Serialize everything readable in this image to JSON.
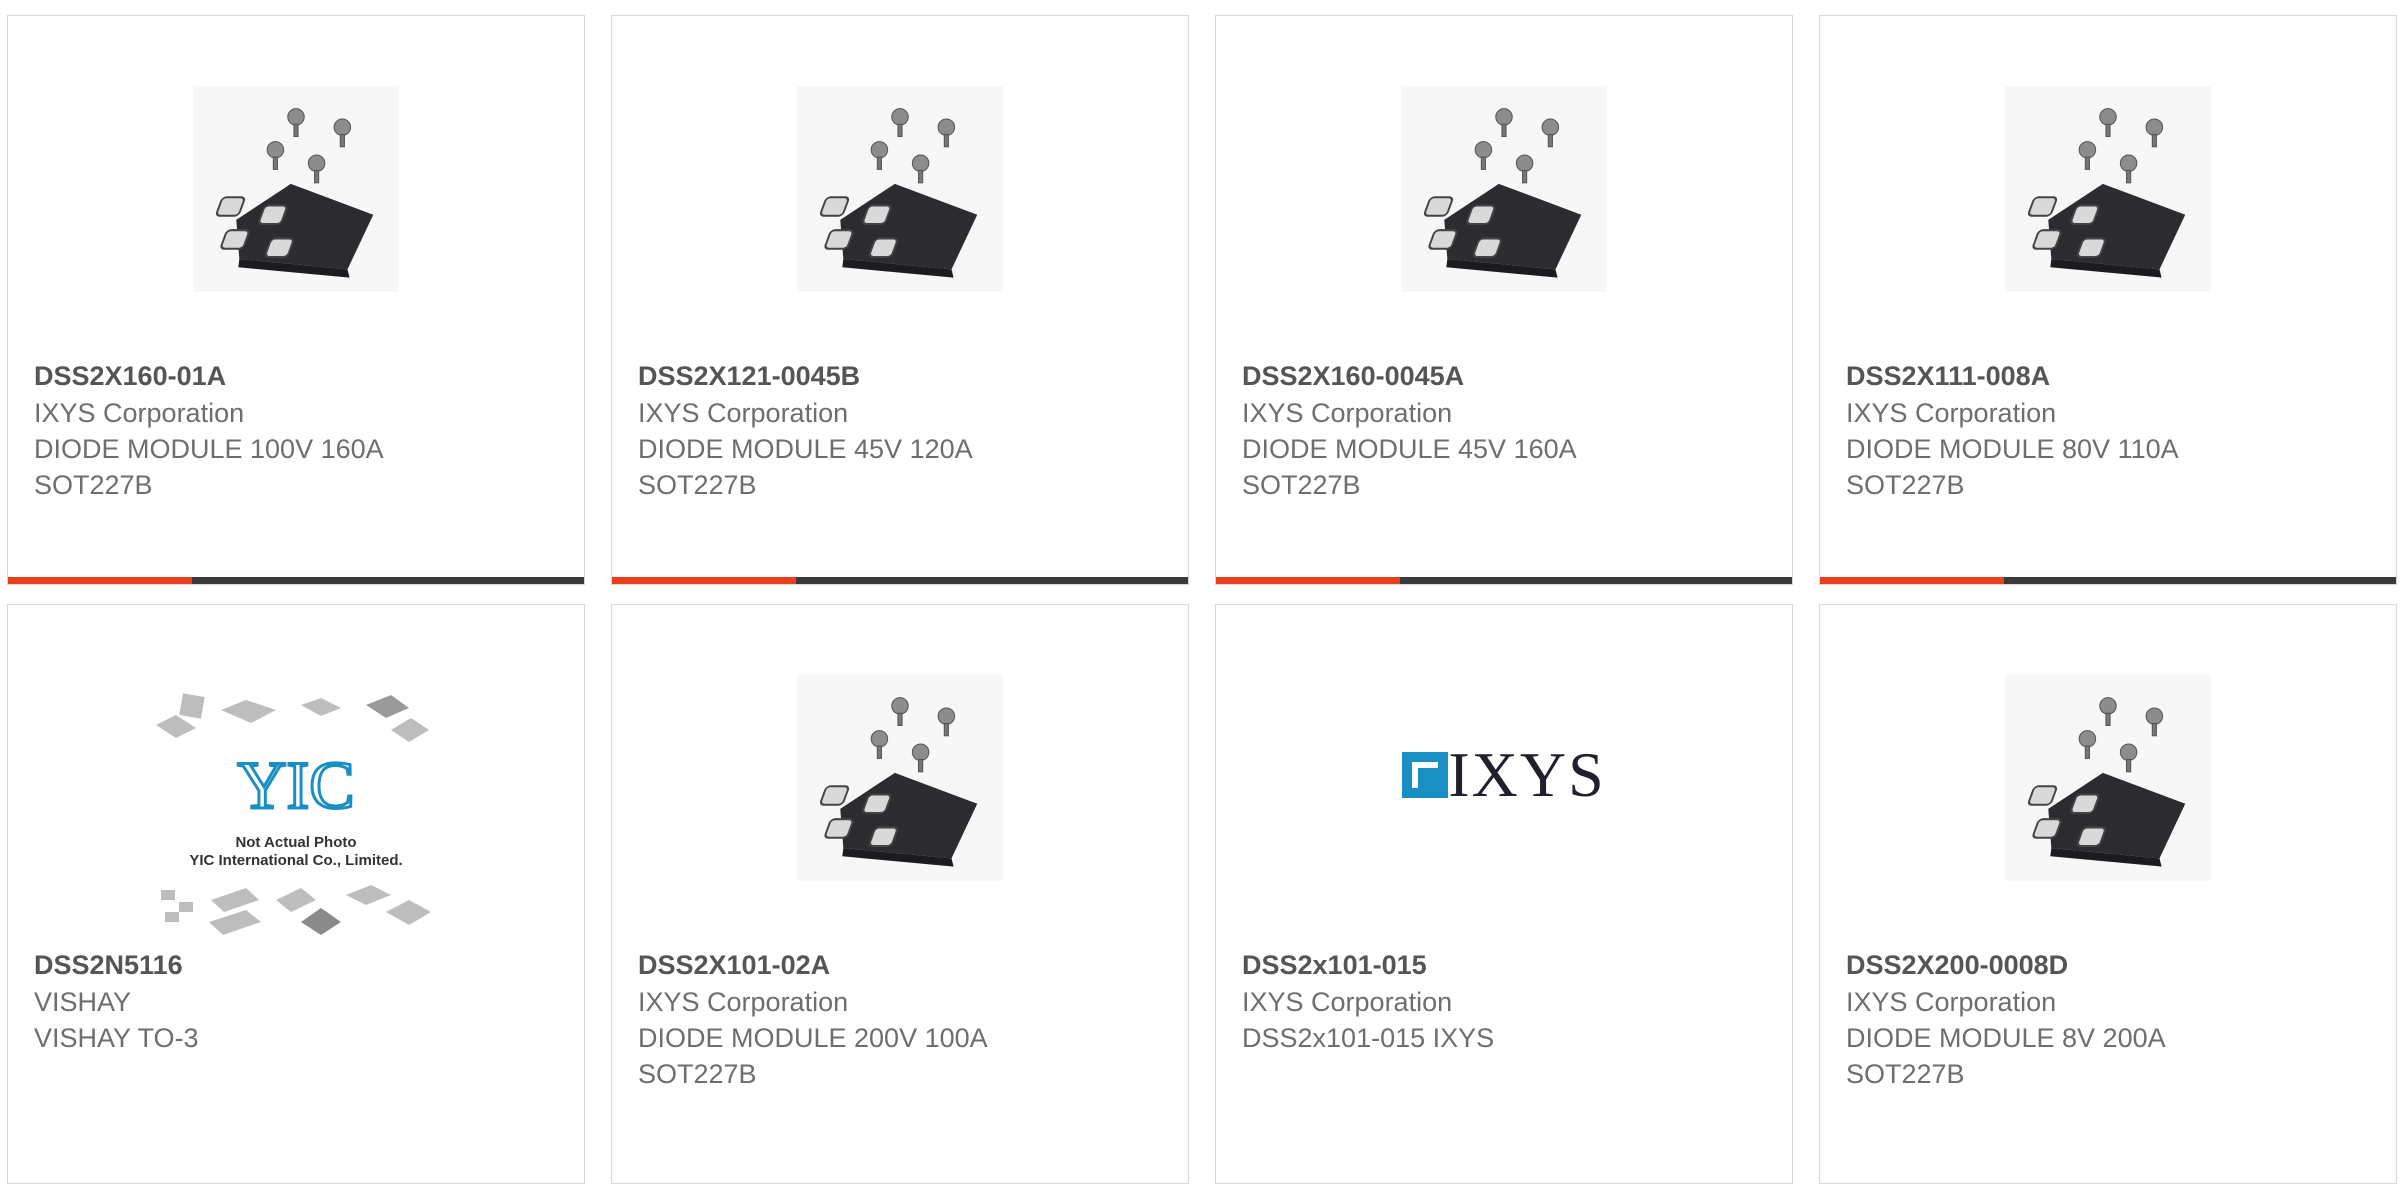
{
  "products": [
    {
      "part": "DSS2X160-01A",
      "mfr": "IXYS Corporation",
      "lines": [
        "DIODE MODULE 100V 160A",
        "SOT227B"
      ],
      "image": "sot227b-module-photo",
      "progress": 0.32
    },
    {
      "part": "DSS2X121-0045B",
      "mfr": "IXYS Corporation",
      "lines": [
        "DIODE MODULE 45V 120A",
        "SOT227B"
      ],
      "image": "sot227b-module-photo",
      "progress": 0.32
    },
    {
      "part": "DSS2X160-0045A",
      "mfr": "IXYS Corporation",
      "lines": [
        "DIODE MODULE 45V 160A",
        "SOT227B"
      ],
      "image": "sot227b-module-photo",
      "progress": 0.32
    },
    {
      "part": "DSS2X111-008A",
      "mfr": "IXYS Corporation",
      "lines": [
        "DIODE MODULE 80V 110A",
        "SOT227B"
      ],
      "image": "sot227b-module-photo",
      "progress": 0.32
    },
    {
      "part": "DSS2N5116",
      "mfr": "VISHAY",
      "lines": [
        "VISHAY TO-3"
      ],
      "image": "yic-placeholder-photo",
      "caption": [
        "Not Actual Photo",
        "YIC International Co., Limited."
      ],
      "logo_text": "YIC"
    },
    {
      "part": "DSS2X101-02A",
      "mfr": "IXYS Corporation",
      "lines": [
        "DIODE MODULE 200V 100A",
        "SOT227B"
      ],
      "image": "sot227b-module-photo"
    },
    {
      "part": "DSS2x101-015",
      "mfr": "IXYS Corporation",
      "lines": [
        "DSS2x101-015 IXYS"
      ],
      "image": "ixys-logo",
      "logo_text": "IXYS"
    },
    {
      "part": "DSS2X200-0008D",
      "mfr": "IXYS Corporation",
      "lines": [
        "DIODE MODULE 8V 200A",
        "SOT227B"
      ],
      "image": "sot227b-module-photo"
    }
  ],
  "colors": {
    "accent": "#e8401c",
    "bar": "#3a3a3a",
    "border": "#d6d6d6",
    "text": "#6e6e6e",
    "logo_blue": "#1a8fc4"
  }
}
